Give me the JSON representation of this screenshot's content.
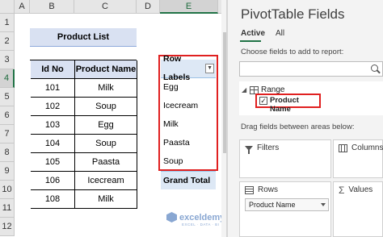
{
  "sheet": {
    "columns": [
      "A",
      "B",
      "C",
      "D",
      "E"
    ],
    "rows": [
      "1",
      "2",
      "3",
      "4",
      "5",
      "6",
      "7",
      "8",
      "9",
      "10",
      "11",
      "12"
    ],
    "title": "Product List",
    "table_headers": [
      "Id No",
      "Product Name"
    ],
    "table_rows": [
      [
        "101",
        "Milk"
      ],
      [
        "102",
        "Soup"
      ],
      [
        "103",
        "Egg"
      ],
      [
        "104",
        "Soup"
      ],
      [
        "105",
        "Paasta"
      ],
      [
        "106",
        "Icecream"
      ],
      [
        "108",
        "Milk"
      ]
    ],
    "pivot": {
      "header": "Row Labels",
      "items": [
        "Egg",
        "Icecream",
        "Milk",
        "Paasta",
        "Soup"
      ],
      "total": "Grand Total"
    }
  },
  "panel": {
    "title": "PivotTable Fields",
    "tabs": [
      "Active",
      "All"
    ],
    "choose_text": "Choose fields to add to report:",
    "range_label": "Range",
    "field_label": "Product Name",
    "drag_text": "Drag fields between areas below:",
    "areas": {
      "filters": "Filters",
      "columns": "Columns",
      "rows": "Rows",
      "values": "Values"
    },
    "rows_chip": "Product Name"
  },
  "watermark": {
    "brand": "exceldemy",
    "tagline": "EXCEL · DATA · BI"
  },
  "colors": {
    "highlight": "#e02020",
    "header_fill": "#d9e1f2",
    "excel_green": "#217346"
  }
}
